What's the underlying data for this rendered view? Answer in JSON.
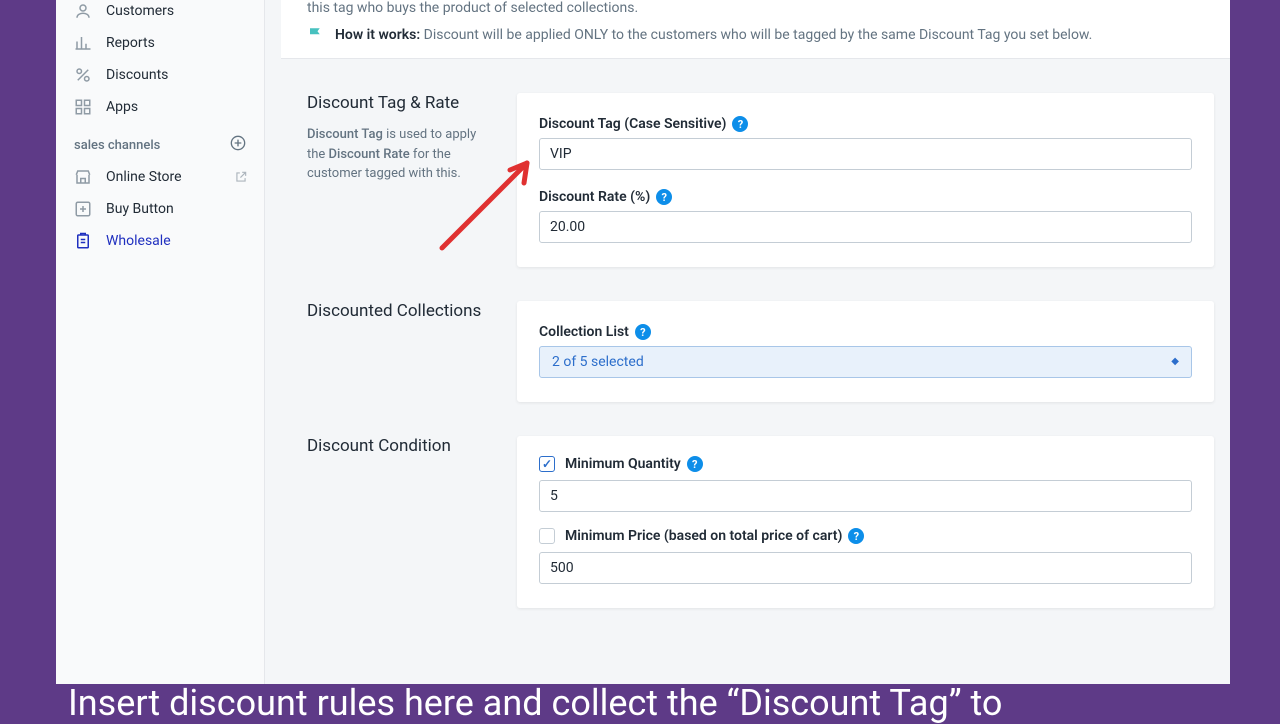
{
  "sidebar": {
    "items": [
      {
        "label": "Customers"
      },
      {
        "label": "Reports"
      },
      {
        "label": "Discounts"
      },
      {
        "label": "Apps"
      }
    ],
    "channels_heading": "sales channels",
    "channels": [
      {
        "label": "Online Store"
      },
      {
        "label": "Buy Button"
      },
      {
        "label": "Wholesale",
        "active": true
      }
    ]
  },
  "intro": {
    "partial_line": "this tag who buys the product of selected collections.",
    "how_label": "How it works:",
    "how_desc": "Discount will be applied ONLY to the customers who will be tagged by the same Discount Tag you set below."
  },
  "discount_tag_rate": {
    "title": "Discount Tag & Rate",
    "sub_pre": "Discount Tag",
    "sub_mid": " is used to apply the ",
    "sub_term": "Discount Rate",
    "sub_post": " for the customer tagged with this.",
    "tag_label": "Discount Tag (Case Sensitive)",
    "tag_value": "VIP",
    "rate_label": "Discount Rate (%)",
    "rate_value": "20.00"
  },
  "discounted_collections": {
    "title": "Discounted Collections",
    "list_label": "Collection List",
    "selected_text": "2 of 5 selected"
  },
  "discount_condition": {
    "title": "Discount Condition",
    "min_qty_label": "Minimum Quantity",
    "min_qty_value": "5",
    "min_qty_checked": true,
    "min_price_label": "Minimum Price (based on total price of cart)",
    "min_price_value": "500",
    "min_price_checked": false
  },
  "caption": "Insert discount rules here and collect the “Discount Tag” to"
}
